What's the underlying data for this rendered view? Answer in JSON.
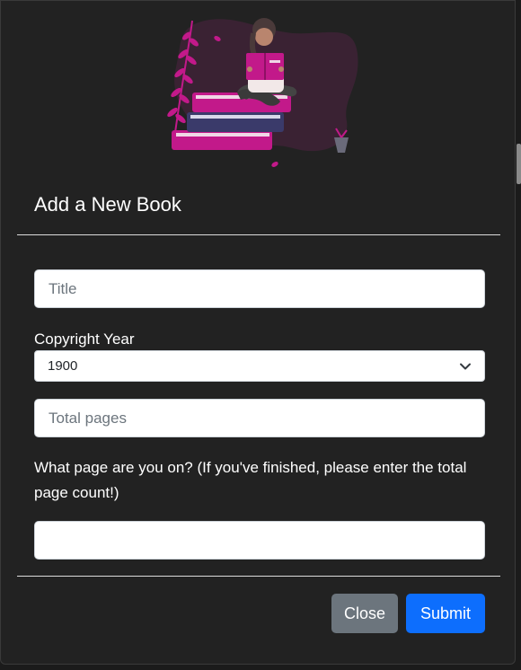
{
  "modal": {
    "title": "Add a New Book"
  },
  "form": {
    "title_placeholder": "Title",
    "copyright_year_label": "Copyright Year",
    "copyright_year_value": "1900",
    "total_pages_placeholder": "Total pages",
    "current_page_label": "What page are you on? (If you've finished, please enter the total page count!)",
    "current_page_value": ""
  },
  "footer": {
    "close_label": "Close",
    "submit_label": "Submit"
  },
  "colors": {
    "background": "#222222",
    "accent_magenta": "#c2198a",
    "book_navy": "#3a3a6a",
    "close_button": "#6c757d",
    "submit_button": "#0d6efd"
  }
}
